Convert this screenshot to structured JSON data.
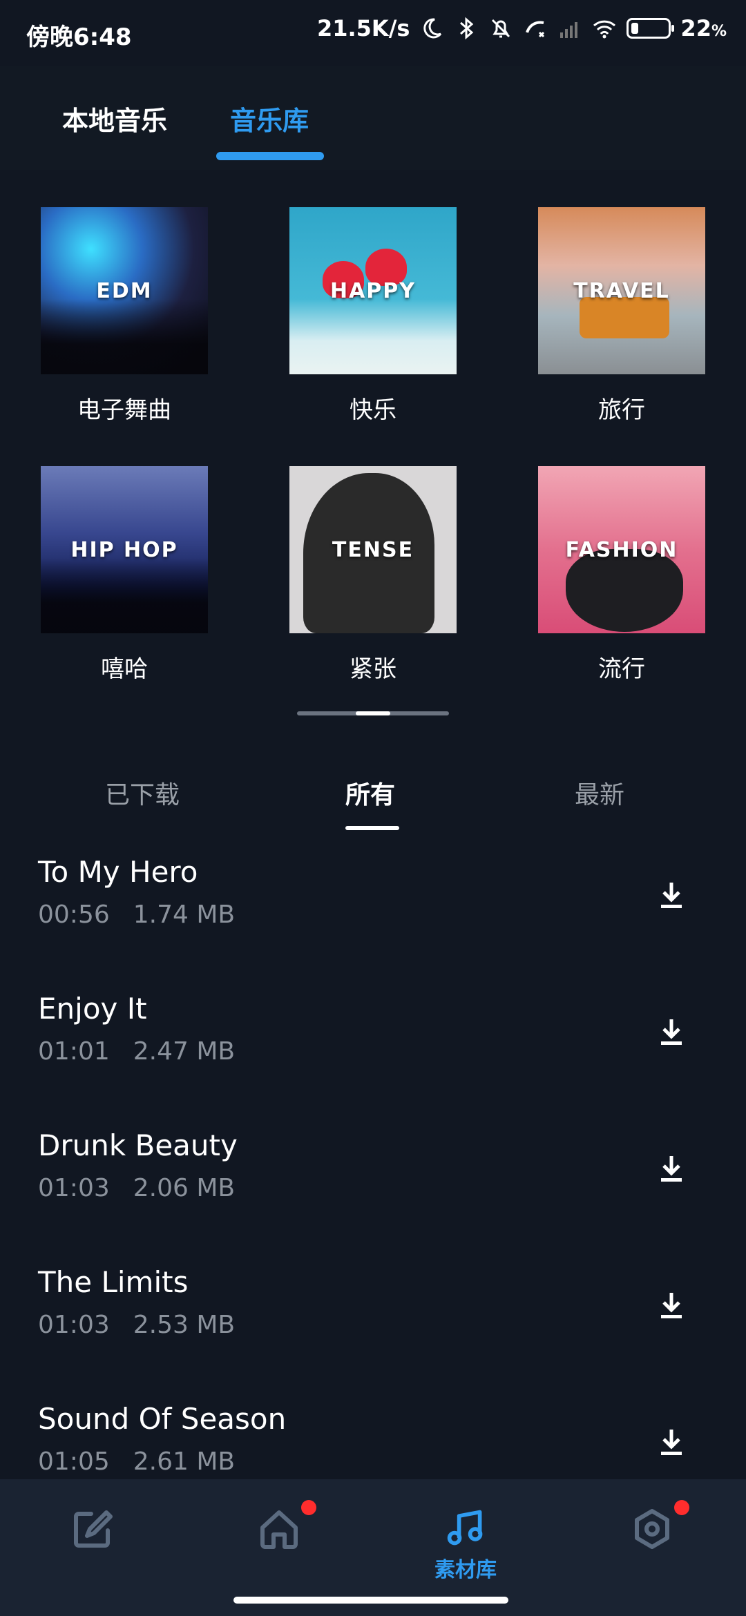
{
  "status_bar": {
    "time": "傍晚6:48",
    "network_speed": "21.5K/s",
    "battery_percent": "22",
    "battery_unit": "%",
    "icons": [
      "moon-icon",
      "bluetooth-icon",
      "mute-bell-icon",
      "call-off-icon",
      "signal-icon",
      "wifi-icon",
      "battery-icon"
    ]
  },
  "top_tabs": [
    {
      "label": "本地音乐",
      "active": false
    },
    {
      "label": "音乐库",
      "active": true
    }
  ],
  "categories": [
    {
      "label": "电子舞曲",
      "cover_text": "EDM"
    },
    {
      "label": "快乐",
      "cover_text": "HAPPY"
    },
    {
      "label": "旅行",
      "cover_text": "TRAVEL"
    },
    {
      "label": "嘻哈",
      "cover_text": "HIP HOP"
    },
    {
      "label": "紧张",
      "cover_text": "TENSE"
    },
    {
      "label": "流行",
      "cover_text": "FASHION"
    }
  ],
  "pager": {
    "page": 2,
    "pages": 3
  },
  "sub_tabs": [
    {
      "label": "已下载",
      "active": false
    },
    {
      "label": "所有",
      "active": true
    },
    {
      "label": "最新",
      "active": false
    }
  ],
  "tracks": [
    {
      "title": "To My Hero",
      "duration": "00:56",
      "size": "1.74 MB"
    },
    {
      "title": "Enjoy It",
      "duration": "01:01",
      "size": "2.47 MB"
    },
    {
      "title": "Drunk Beauty",
      "duration": "01:03",
      "size": "2.06 MB"
    },
    {
      "title": "The Limits",
      "duration": "01:03",
      "size": "2.53 MB"
    },
    {
      "title": "Sound Of Season",
      "duration": "01:05",
      "size": "2.61 MB"
    }
  ],
  "bottom_nav": [
    {
      "icon": "edit-icon",
      "label": "",
      "badge": false
    },
    {
      "icon": "home-icon",
      "label": "",
      "badge": true
    },
    {
      "icon": "music-note-icon",
      "label": "素材库",
      "badge": false,
      "active": true
    },
    {
      "icon": "settings-hex-icon",
      "label": "",
      "badge": true
    }
  ],
  "colors": {
    "accent": "#2f9bf0",
    "background": "#111722",
    "badge": "#ff2d2d"
  }
}
